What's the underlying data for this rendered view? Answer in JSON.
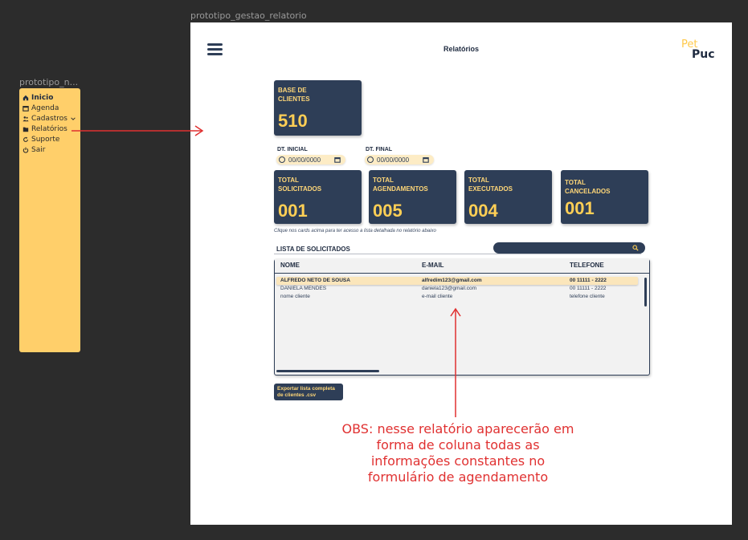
{
  "canvas": {
    "main_frame_name": "prototipo_gestao_relatorio",
    "side_frame_name": "prototipo_n..."
  },
  "sidebar": {
    "items": [
      {
        "label": "Inicio",
        "icon": "home-icon",
        "active": true
      },
      {
        "label": "Agenda",
        "icon": "calendar-icon",
        "active": false
      },
      {
        "label": "Cadastros",
        "icon": "users-icon",
        "active": false,
        "chevron": "chevron-down-icon"
      },
      {
        "label": "Relatórios",
        "icon": "folder-icon",
        "active": false
      },
      {
        "label": "Suporte",
        "icon": "refresh-icon",
        "active": false
      },
      {
        "label": "Sair",
        "icon": "power-icon",
        "active": false
      }
    ]
  },
  "header": {
    "title": "Relatórios",
    "logo_pet": "Pet",
    "logo_puc": "Puc"
  },
  "base_card": {
    "title": "BASE DE CLIENTES",
    "value": "510"
  },
  "filters": {
    "start_label": "DT. INICIAL",
    "start_value": "00/00/0000",
    "end_label": "DT. FINAL",
    "end_value": "00/00/0000"
  },
  "stat_cards": [
    {
      "title": "TOTAL SOLICITADOS",
      "value": "001"
    },
    {
      "title": "TOTAL AGENDAMENTOS",
      "value": "005"
    },
    {
      "title": "TOTAL EXECUTADOS",
      "value": "004"
    },
    {
      "title": "TOTAL CANCELADOS",
      "value": "001"
    }
  ],
  "hint": "Clique nos cards acima para ter acesso a lista detalhada no relatório abaixo",
  "list": {
    "title": "LISTA DE SOLICITADOS",
    "columns": [
      "NOME",
      "E-MAIL",
      "TELEFONE"
    ],
    "rows": [
      [
        "ALFREDO NETO DE SOUSA",
        "alfredim123@gmail.com",
        "00 11111 - 2222"
      ],
      [
        "DANIELA MENDES",
        "daniela123@gmail.com",
        "00 11111 - 2222"
      ],
      [
        "nome cliente",
        "e-mail cliente",
        "telefone cliente"
      ]
    ]
  },
  "export_button": "Exportar lista completa de clientes .csv",
  "note": "OBS: nesse relatório aparecerão em forma de coluna todas as informações constantes no formulário de agendamento",
  "colors": {
    "navy": "#2e3e57",
    "accent_yellow": "#ffcf55",
    "sidebar_yellow": "#ffcf6a",
    "annotation_red": "#e03131"
  }
}
